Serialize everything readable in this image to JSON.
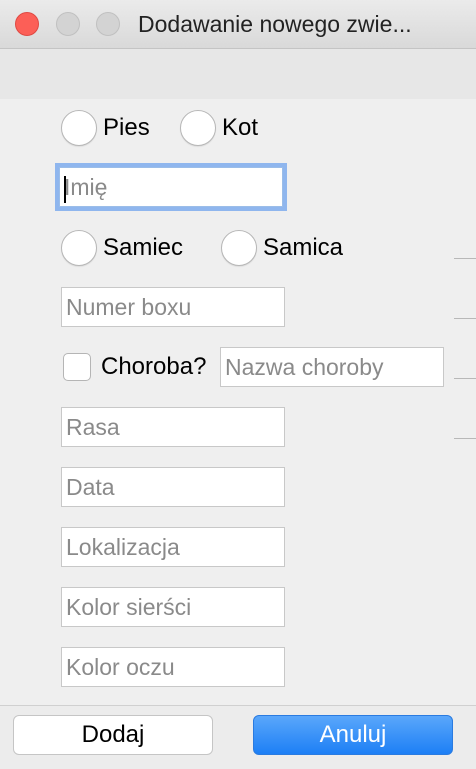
{
  "window": {
    "title": "Dodawanie nowego zwie..."
  },
  "species": {
    "options": [
      "Pies",
      "Kot"
    ]
  },
  "name_field": {
    "placeholder": "Imię",
    "value": ""
  },
  "sex": {
    "options": [
      "Samiec",
      "Samica"
    ]
  },
  "fields": {
    "box_number": "Numer boxu",
    "illness_checkbox": "Choroba?",
    "illness_name": "Nazwa choroby",
    "breed": "Rasa",
    "date": "Data",
    "location": "Lokalizacja",
    "fur_color": "Kolor sierści",
    "eye_color": "Kolor oczu"
  },
  "buttons": {
    "add": "Dodaj",
    "cancel": "Anuluj"
  },
  "colors": {
    "accent_blue": "#1d7ff5",
    "close_red": "#fc5f57",
    "focus_ring": "#8fb6ee"
  }
}
